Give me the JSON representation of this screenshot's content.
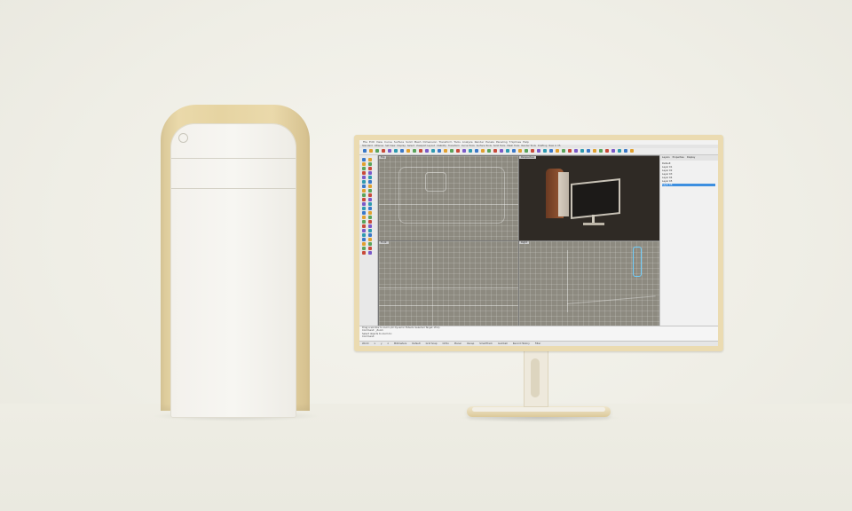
{
  "scene": {
    "colors": {
      "wood": "#e6d4a2",
      "panel_white": "#f5f3ee",
      "background": "#f0efe7",
      "viewport_dark": "#2d2824"
    }
  },
  "cad_app": {
    "menu": [
      "File",
      "Edit",
      "View",
      "Curve",
      "Surface",
      "Solid",
      "Mesh",
      "Dimension",
      "Transform",
      "Tools",
      "Analyze",
      "Render",
      "Panels",
      "Paneling",
      "T-Splines",
      "Help"
    ],
    "tabs": [
      "Standard",
      "CPlanes",
      "Set View",
      "Display",
      "Select",
      "Viewport Layout",
      "Visibility",
      "Transform",
      "Curve Tools",
      "Surface Tools",
      "Solid Tools",
      "Mesh Tools",
      "Render Tools",
      "Drafting",
      "New in V5"
    ],
    "viewports": [
      "Top",
      "Perspective",
      "Front",
      "Right"
    ],
    "panel_tabs": [
      "Layers",
      "Properties",
      "Display"
    ],
    "layers": [
      "Default",
      "Layer 01",
      "Layer 02",
      "Layer 03",
      "Layer 04",
      "Layer 05",
      "Layer 06"
    ],
    "command_history": [
      "Drag a window to zoom (All Dynamic Extents Selected Target 1To1):",
      "Command: _Zoom",
      "Select objects to zoom to:",
      "Command:"
    ],
    "status": [
      "World",
      "x",
      "y",
      "z",
      "Millimeters",
      "Default",
      "Grid Snap",
      "Ortho",
      "Planar",
      "Osnap",
      "SmartTrack",
      "Gumball",
      "Record History",
      "Filter"
    ]
  }
}
